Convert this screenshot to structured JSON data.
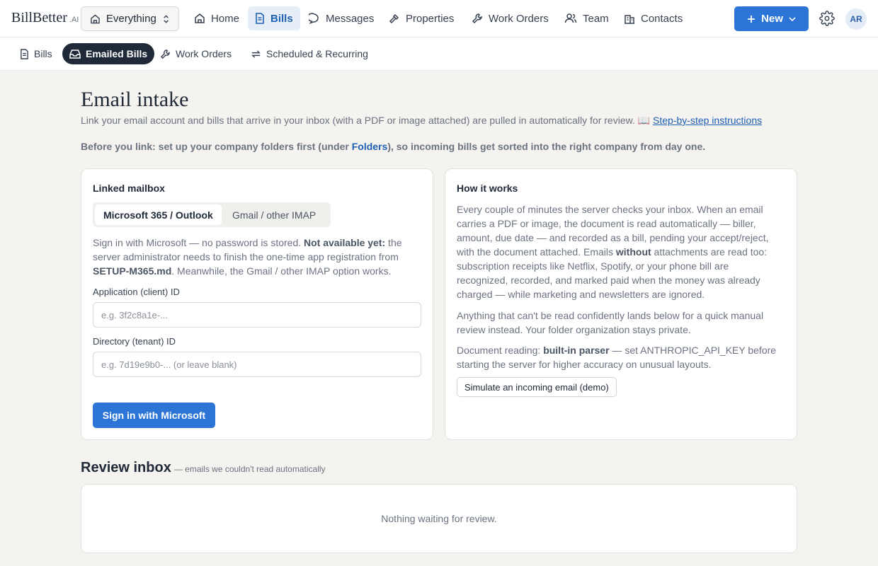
{
  "brand": {
    "name": "BillBetter",
    "suffix": ".AI"
  },
  "workspace": {
    "label": "Everything"
  },
  "nav": {
    "home": "Home",
    "bills": "Bills",
    "messages": "Messages",
    "properties": "Properties",
    "work_orders": "Work Orders",
    "team": "Team",
    "contacts": "Contacts"
  },
  "new_button": "New",
  "avatar_initials": "AR",
  "subnav": {
    "bills": "Bills",
    "emailed_bills": "Emailed Bills",
    "work_orders": "Work Orders",
    "scheduled": "Scheduled & Recurring"
  },
  "page": {
    "title": "Email intake",
    "intro": "Link your email account and bills that arrive in your inbox (with a PDF or image attached) are pulled in automatically for review. 📖 ",
    "instructions_link": "Step-by-step instructions",
    "warning_pre": "Before you link: set up your company folders first (under ",
    "warning_link": "Folders",
    "warning_post": "), so incoming bills get sorted into the right company from day one."
  },
  "mailbox": {
    "title": "Linked mailbox",
    "tab_ms": "Microsoft 365 / Outlook",
    "tab_imap": "Gmail / other IMAP",
    "desc_1": "Sign in with Microsoft — no password is stored. ",
    "desc_2": "Not available yet:",
    "desc_3": " the server administrator needs to finish the one-time app registration from ",
    "desc_4": "SETUP-M365.md",
    "desc_5": ". Meanwhile, the Gmail / other IMAP option works.",
    "client_id_label": "Application (client) ID",
    "client_id_placeholder": "e.g. 3f2c8a1e-...",
    "tenant_id_label": "Directory (tenant) ID",
    "tenant_id_placeholder": "e.g. 7d19e9b0-... (or leave blank)",
    "signin_button": "Sign in with Microsoft"
  },
  "how": {
    "title": "How it works",
    "p1a": "Every couple of minutes the server checks your inbox. When an email carries a PDF or image, the document is read automatically — biller, amount, due date — and recorded as a bill, pending your accept/reject, with the document attached. Emails ",
    "p1b": "without",
    "p1c": " attachments are read too: subscription receipts like Netflix, Spotify, or your phone bill are recognized, recorded, and marked paid when the money was already charged — while marketing and newsletters are ignored.",
    "p2": "Anything that can't be read confidently lands below for a quick manual review instead. Your folder organization stays private.",
    "p3a": "Document reading: ",
    "p3b": "built-in parser",
    "p3c": " — set ANTHROPIC_API_KEY before starting the server for higher accuracy on unusual layouts.",
    "simulate_button": "Simulate an incoming email (demo)"
  },
  "review": {
    "title": "Review inbox",
    "subtitle": "— emails we couldn't read automatically",
    "empty": "Nothing waiting for review."
  },
  "colors": {
    "accent": "#2c74d6",
    "active_nav_bg": "#e6eef8",
    "dark_pill": "#1f2937",
    "page_bg": "#f4f3ef"
  }
}
